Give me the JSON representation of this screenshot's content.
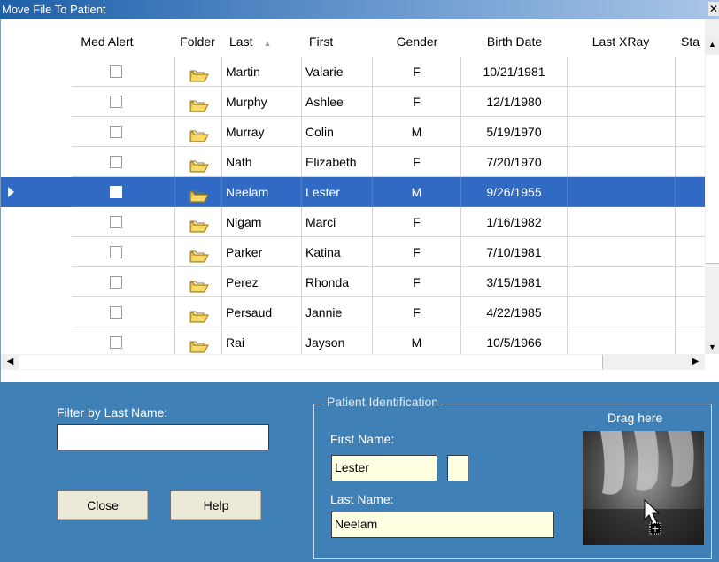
{
  "window": {
    "title": "Move File To Patient",
    "close_glyph": "✕"
  },
  "grid": {
    "columns": [
      "Med Alert",
      "Folder",
      "Last",
      "First",
      "Gender",
      "Birth Date",
      "Last XRay",
      "Sta"
    ],
    "sorted_column": "Last",
    "rows": [
      {
        "last": "Martin",
        "first": "Valarie",
        "gender": "F",
        "birth_date": "10/21/1981",
        "selected": false
      },
      {
        "last": "Murphy",
        "first": "Ashlee",
        "gender": "F",
        "birth_date": "12/1/1980",
        "selected": false
      },
      {
        "last": "Murray",
        "first": "Colin",
        "gender": "M",
        "birth_date": "5/19/1970",
        "selected": false
      },
      {
        "last": "Nath",
        "first": "Elizabeth",
        "gender": "F",
        "birth_date": "7/20/1970",
        "selected": false
      },
      {
        "last": "Neelam",
        "first": "Lester",
        "gender": "M",
        "birth_date": "9/26/1955",
        "selected": true
      },
      {
        "last": "Nigam",
        "first": "Marci",
        "gender": "F",
        "birth_date": "1/16/1982",
        "selected": false
      },
      {
        "last": "Parker",
        "first": "Katina",
        "gender": "F",
        "birth_date": "7/10/1981",
        "selected": false
      },
      {
        "last": "Perez",
        "first": "Rhonda",
        "gender": "F",
        "birth_date": "3/15/1981",
        "selected": false
      },
      {
        "last": "Persaud",
        "first": "Jannie",
        "gender": "F",
        "birth_date": "4/22/1985",
        "selected": false
      },
      {
        "last": "Rai",
        "first": "Jayson",
        "gender": "M",
        "birth_date": "10/5/1966",
        "selected": false
      }
    ]
  },
  "filter": {
    "label": "Filter by Last Name:",
    "value": ""
  },
  "buttons": {
    "close": "Close",
    "help": "Help"
  },
  "patient_identification": {
    "title": "Patient Identification",
    "first_name_label": "First Name:",
    "first_name_value": "Lester",
    "last_name_label": "Last Name:",
    "last_name_value": "Neelam",
    "drag_label": "Drag here"
  },
  "colors": {
    "selection": "#316ac5",
    "panel": "#3f80b6",
    "folder": "#f3c64a",
    "field": "#ffffe1"
  }
}
